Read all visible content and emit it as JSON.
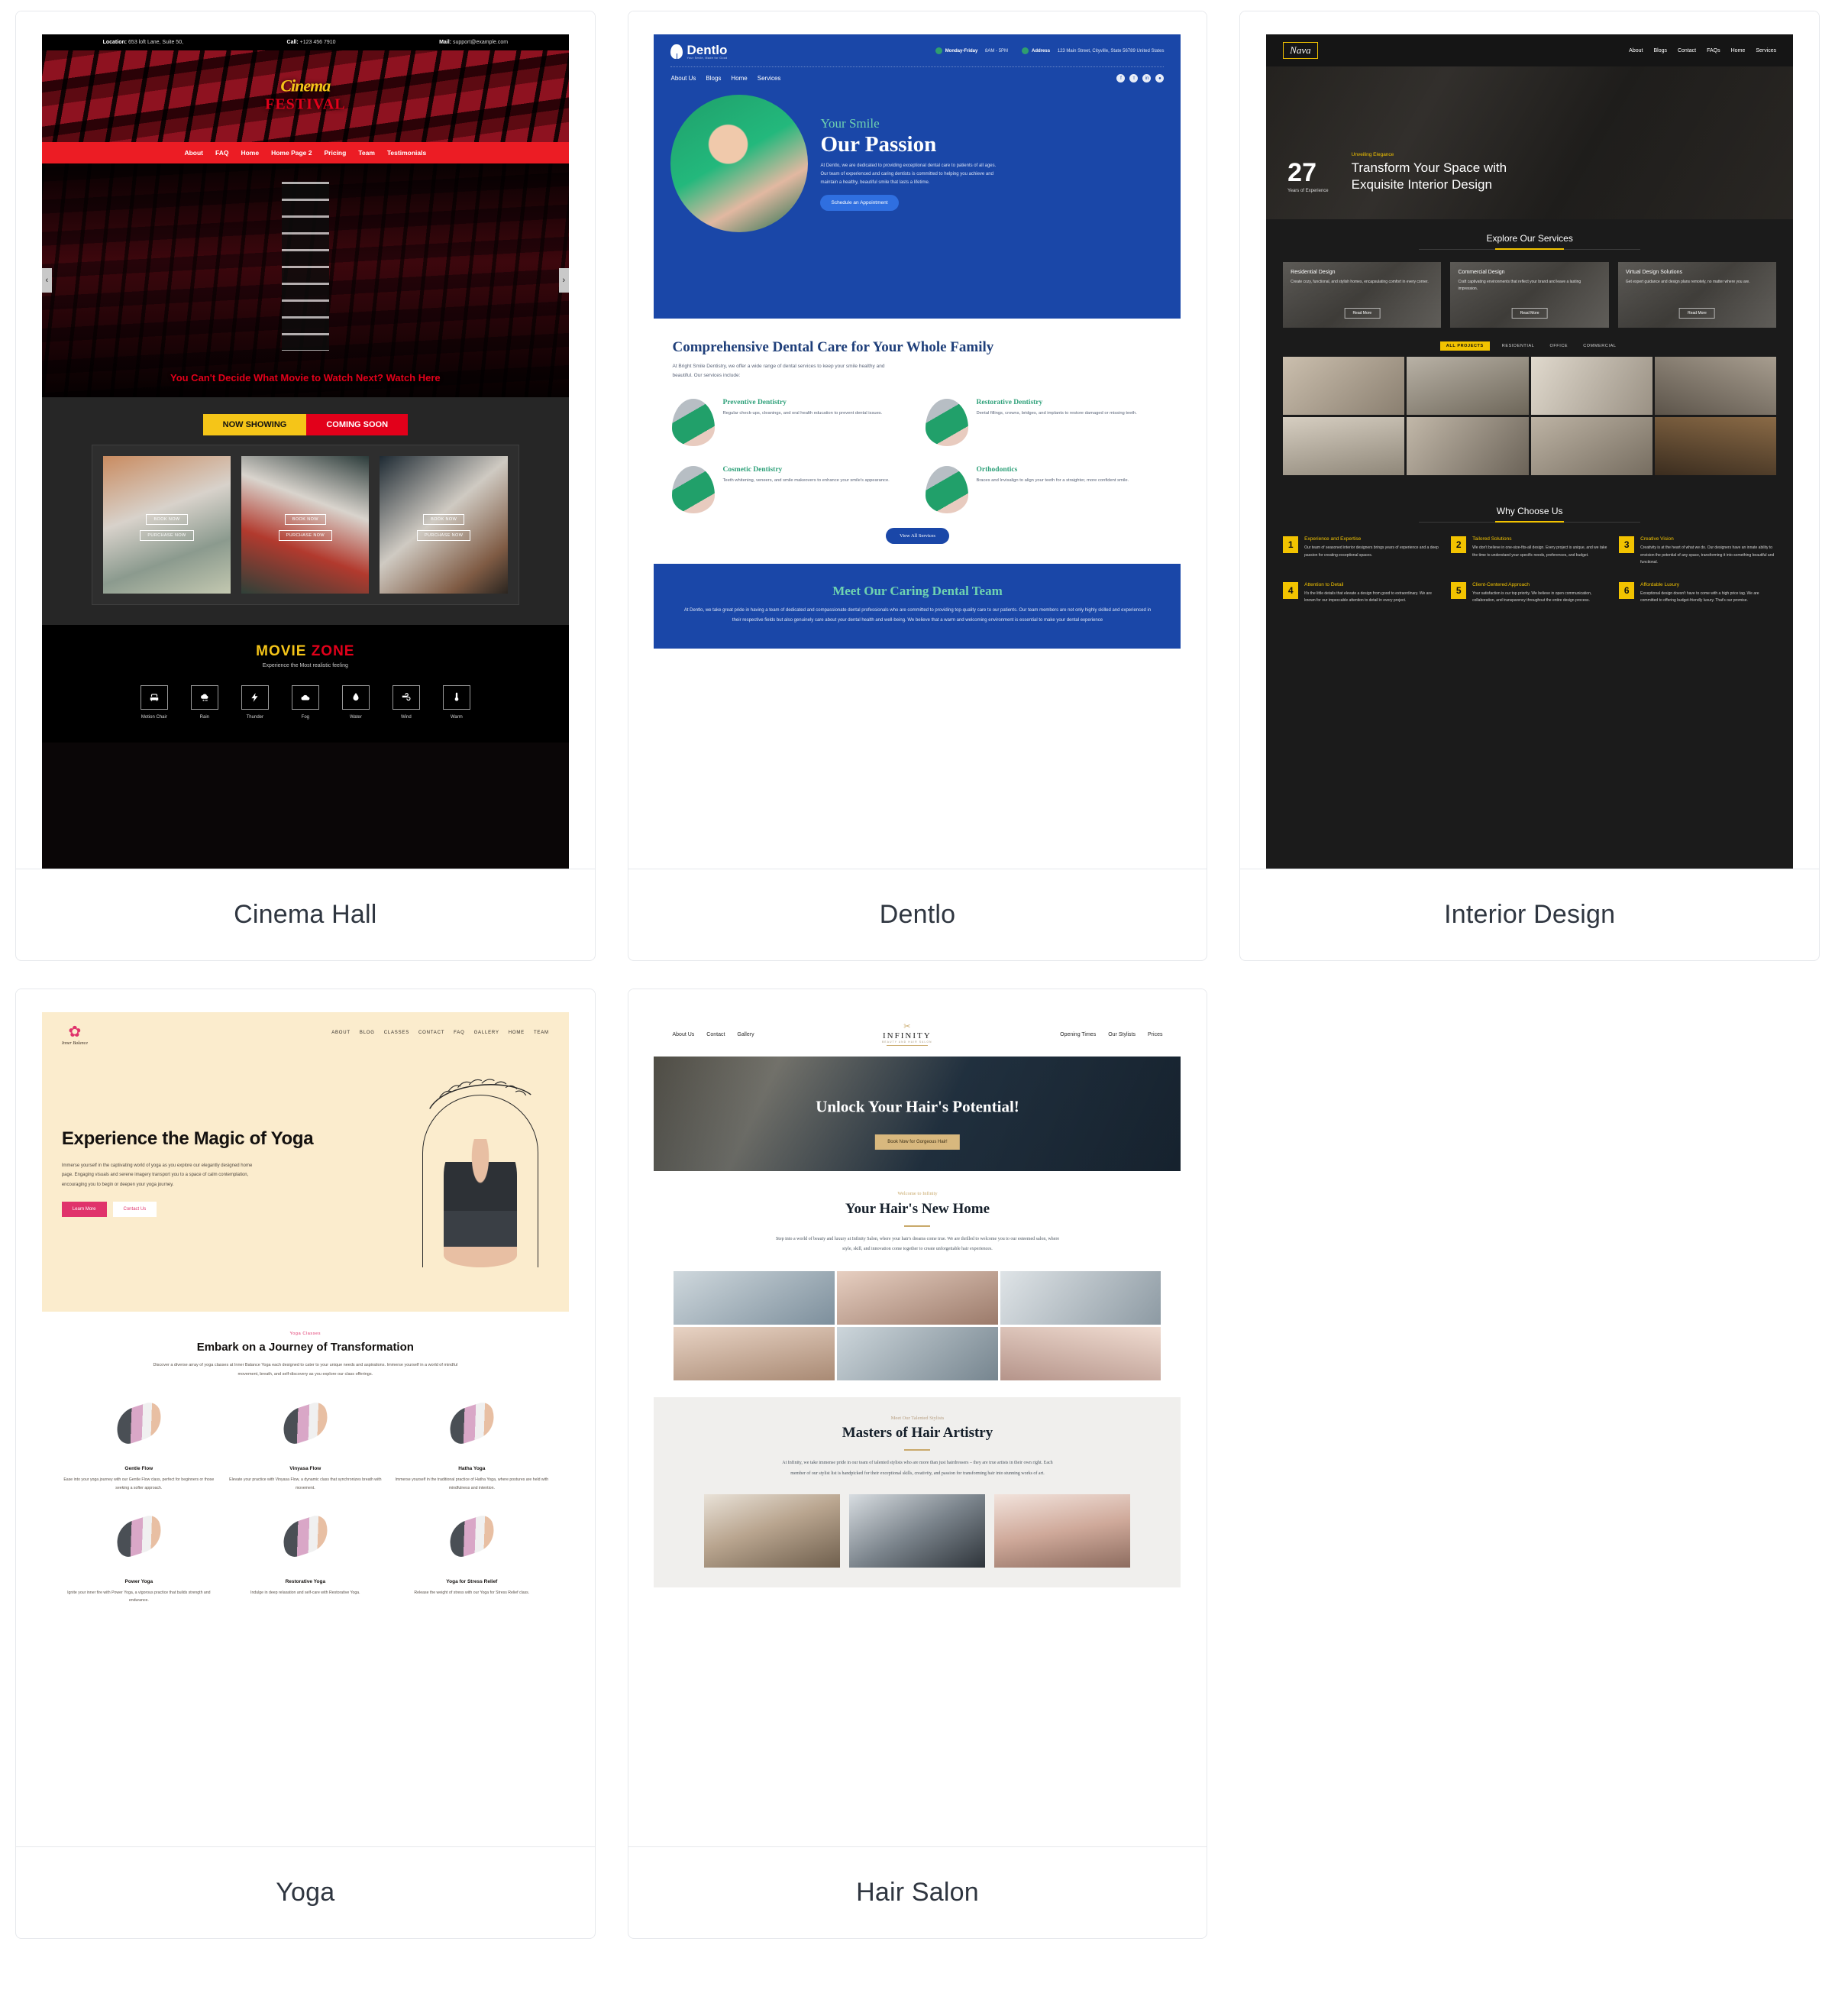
{
  "grid": {
    "cards": [
      {
        "id": "cinema-hall",
        "label": "Cinema Hall"
      },
      {
        "id": "dentlo",
        "label": "Dentlo"
      },
      {
        "id": "interior-design",
        "label": "Interior Design"
      },
      {
        "id": "yoga",
        "label": "Yoga"
      },
      {
        "id": "hair-salon",
        "label": "Hair Salon"
      }
    ]
  },
  "cinema": {
    "topbar": {
      "location_label": "Location:",
      "location_value": "653 loft Lane, Suite 50,",
      "call_label": "Call:",
      "call_value": "+123 456 7910",
      "mail_label": "Mail:",
      "mail_value": "support@example.com"
    },
    "logo_line1": "Cinema",
    "logo_line2": "FESTIVAL",
    "nav": [
      "About",
      "FAQ",
      "Home",
      "Home Page 2",
      "Pricing",
      "Team",
      "Testimonials"
    ],
    "prev_arrow": "‹",
    "next_arrow": "›",
    "tagline": "You Can't Decide What Movie to Watch Next?",
    "tagline_link": "Watch Here",
    "tabs": [
      {
        "label": "NOW SHOWING",
        "active": true
      },
      {
        "label": "COMING SOON",
        "active": false
      }
    ],
    "poster_buttons": [
      "BOOK NOW",
      "PURCHASE NOW"
    ],
    "zone_title_1": "MOVIE ",
    "zone_title_2": "ZONE",
    "zone_sub": "Experience the Most realistic feeling",
    "features": [
      {
        "icon": "motion-chair-icon",
        "label": "Motion Chair"
      },
      {
        "icon": "rain-icon",
        "label": "Rain"
      },
      {
        "icon": "thunder-icon",
        "label": "Thunder"
      },
      {
        "icon": "fog-icon",
        "label": "Fog"
      },
      {
        "icon": "water-icon",
        "label": "Water"
      },
      {
        "icon": "wind-icon",
        "label": "Wind"
      },
      {
        "icon": "warm-icon",
        "label": "Warm"
      }
    ]
  },
  "dentlo": {
    "brand": "Dentlo",
    "brand_sub": "Your Smile, Made for Good",
    "hours_label": "Monday-Friday",
    "hours_value": "8AM - 5PM",
    "address_label": "Address",
    "address_value": "123 Main Street, Cityville, State 56789 United States",
    "nav": [
      "About Us",
      "Blogs",
      "Home",
      "Services"
    ],
    "social": [
      "f",
      "ᴛ",
      "in",
      "●"
    ],
    "hero_kicker": "Your Smile",
    "hero_title": "Our Passion",
    "hero_body": "At Dentlo, we are dedicated to providing exceptional dental care to patients of all ages. Our team of experienced and caring dentists is committed to helping you achieve and maintain a healthy, beautiful smile that lasts a lifetime.",
    "hero_button": "Schedule an Appointment",
    "services_title": "Comprehensive Dental Care for Your Whole Family",
    "services_lead": "At Bright Smile Dentistry, we offer a wide range of dental services to keep your smile healthy and beautiful. Our services include:",
    "services": [
      {
        "title": "Preventive Dentistry",
        "body": "Regular check-ups, cleanings, and oral health education to prevent dental issues."
      },
      {
        "title": "Restorative Dentistry",
        "body": "Dental fillings, crowns, bridges, and implants to restore damaged or missing teeth."
      },
      {
        "title": "Cosmetic Dentistry",
        "body": "Teeth whitening, veneers, and smile makeovers to enhance your smile's appearance."
      },
      {
        "title": "Orthodontics",
        "body": "Braces and Invisalign to align your teeth for a straighter, more confident smile."
      }
    ],
    "view_all": "View All Services",
    "team_title": "Meet Our Caring Dental Team",
    "team_body": "At Dentlo, we take great pride in having a team of dedicated and compassionate dental professionals who are committed to providing top-quality care to our patients. Our team members are not only highly skilled and experienced in their respective fields but also genuinely care about your dental health and well-being. We believe that a warm and welcoming environment is essential to make your dental experience"
  },
  "interior": {
    "brand": "Nava",
    "nav": [
      "About",
      "Blogs",
      "Contact",
      "FAQs",
      "Home",
      "Services"
    ],
    "years_number": "27",
    "years_label": "Years of Experience",
    "hero_kicker": "Unveiling Elegance",
    "hero_title": "Transform Your Space with Exquisite Interior Design",
    "services_heading": "Explore Our Services",
    "services": [
      {
        "title": "Residential Design",
        "body": "Create cozy, functional, and stylish homes, encapsulating comfort in every corner.",
        "cta": "Read More"
      },
      {
        "title": "Commercial Design",
        "body": "Craft captivating environments that reflect your brand and leave a lasting impression.",
        "cta": "Read More"
      },
      {
        "title": "Virtual Design Solutions",
        "body": "Get expert guidance and design plans remotely, no matter where you are.",
        "cta": "Read More"
      }
    ],
    "filters": [
      {
        "label": "ALL PROJECTS",
        "active": true
      },
      {
        "label": "RESIDENTIAL",
        "active": false
      },
      {
        "label": "OFFICE",
        "active": false
      },
      {
        "label": "COMMERCIAL",
        "active": false
      }
    ],
    "why_heading": "Why Choose Us",
    "why_items": [
      {
        "num": "1",
        "title": "Experience and Expertise",
        "body": "Our team of seasoned interior designers brings years of experience and a deep passion for creating exceptional spaces."
      },
      {
        "num": "2",
        "title": "Tailored Solutions",
        "body": "We don't believe in one-size-fits-all design. Every project is unique, and we take the time to understand your specific needs, preferences, and budget."
      },
      {
        "num": "3",
        "title": "Creative Vision",
        "body": "Creativity is at the heart of what we do. Our designers have an innate ability to envision the potential of any space, transforming it into something beautiful and functional."
      },
      {
        "num": "4",
        "title": "Attention to Detail",
        "body": "It's the little details that elevate a design from good to extraordinary. We are known for our impeccable attention to detail in every project."
      },
      {
        "num": "5",
        "title": "Client-Centered Approach",
        "body": "Your satisfaction is our top priority. We believe in open communication, collaboration, and transparency throughout the entire design process."
      },
      {
        "num": "6",
        "title": "Affordable Luxury",
        "body": "Exceptional design doesn't have to come with a high price tag. We are committed to offering budget-friendly luxury. That's our promise."
      }
    ]
  },
  "yoga": {
    "brand": "Inner Balance",
    "nav": [
      "ABOUT",
      "BLOG",
      "CLASSES",
      "CONTACT",
      "FAQ",
      "GALLERY",
      "HOME",
      "TEAM"
    ],
    "hero_title": "Experience the Magic of Yoga",
    "hero_body": "Immerse yourself in the captivating world of yoga as you explore our elegantly designed home page. Engaging visuals and serene imagery transport you to a space of calm contemplation, encouraging you to begin or deepen your yoga journey.",
    "btn_primary": "Learn More",
    "btn_secondary": "Contact Us",
    "classes_kicker": "Yoga Classes",
    "classes_title": "Embark on a Journey of Transformation",
    "classes_lead": "Discover a diverse array of yoga classes at Inner Balance Yoga each designed to cater to your unique needs and aspirations. Immerse yourself in a world of mindful movement, breath, and self-discovery as you explore our class offerings.",
    "classes": [
      {
        "title": "Gentle Flow",
        "body": "Ease into your yoga journey with our Gentle Flow class, perfect for beginners or those seeking a softer approach."
      },
      {
        "title": "Vinyasa Flow",
        "body": "Elevate your practice with Vinyasa Flow, a dynamic class that synchronizes breath with movement."
      },
      {
        "title": "Hatha Yoga",
        "body": "Immerse yourself in the traditional practice of Hatha Yoga, where postures are held with mindfulness and intention."
      },
      {
        "title": "Power Yoga",
        "body": "Ignite your inner fire with Power Yoga, a vigorous practice that builds strength and endurance."
      },
      {
        "title": "Restorative Yoga",
        "body": "Indulge in deep relaxation and self-care with Restorative Yoga."
      },
      {
        "title": "Yoga for Stress Relief",
        "body": "Release the weight of stress with our Yoga for Stress Relief class."
      }
    ]
  },
  "hair": {
    "brand": "INFINITY",
    "brand_sub": "BEAUTY AND HAIR SALON",
    "nav_left": [
      "About Us",
      "Contact",
      "Gallery"
    ],
    "nav_right": [
      "Opening Times",
      "Our Stylists",
      "Prices"
    ],
    "hero_title": "Unlock Your Hair's Potential!",
    "hero_cta": "Book Now for Gorgeous Hair!",
    "welcome_kicker": "Welcome to Infinity",
    "welcome_title": "Your Hair's New Home",
    "welcome_body": "Step into a world of beauty and luxury at Infinity Salon, where your hair's dreams come true. We are thrilled to welcome you to our esteemed salon, where style, skill, and innovation come together to create unforgettable hair experiences.",
    "stylists_kicker": "Meet Our Talented Stylists",
    "stylists_title": "Masters of Hair Artistry",
    "stylists_body": "At Infinity, we take immense pride in our team of talented stylists who are more than just hairdressers – they are true artists in their own right. Each member of our stylist list is handpicked for their exceptional skills, creativity, and passion for transforming hair into stunning works of art."
  }
}
